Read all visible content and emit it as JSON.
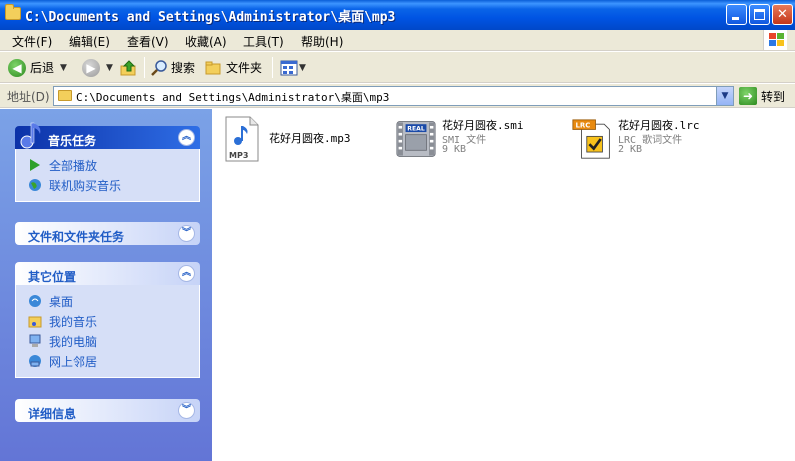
{
  "window": {
    "title": "C:\\Documents and Settings\\Administrator\\桌面\\mp3",
    "icon": "folder-icon"
  },
  "menu": {
    "items": [
      "文件(F)",
      "编辑(E)",
      "查看(V)",
      "收藏(A)",
      "工具(T)",
      "帮助(H)"
    ]
  },
  "toolbar": {
    "back_label": "后退",
    "search_label": "搜索",
    "folders_label": "文件夹"
  },
  "address": {
    "label": "地址(D)",
    "value": "C:\\Documents and Settings\\Administrator\\桌面\\mp3",
    "go_label": "转到"
  },
  "taskpane": {
    "music_tasks": {
      "title": "音乐任务",
      "links": [
        "全部播放",
        "联机购买音乐"
      ]
    },
    "file_folder_tasks": {
      "title": "文件和文件夹任务"
    },
    "other_places": {
      "title": "其它位置",
      "links": [
        "桌面",
        "我的音乐",
        "我的电脑",
        "网上邻居"
      ]
    },
    "details": {
      "title": "详细信息"
    }
  },
  "files": [
    {
      "name": "花好月圆夜.mp3",
      "type": "",
      "size": "",
      "icon": "mp3-file-icon",
      "icon_label": "MP3"
    },
    {
      "name": "花好月圆夜.smi",
      "type": "SMI 文件",
      "size": "9 KB",
      "icon": "real-smi-file-icon",
      "icon_label": "REAL"
    },
    {
      "name": "花好月圆夜.lrc",
      "type": "LRC 歌词文件",
      "size": "2 KB",
      "icon": "lrc-file-icon",
      "icon_label": "LRC"
    }
  ],
  "colors": {
    "title_bar": "#0054e3",
    "task_pane": "#6375d6",
    "link": "#215dc6",
    "chrome": "#ece9d8"
  }
}
